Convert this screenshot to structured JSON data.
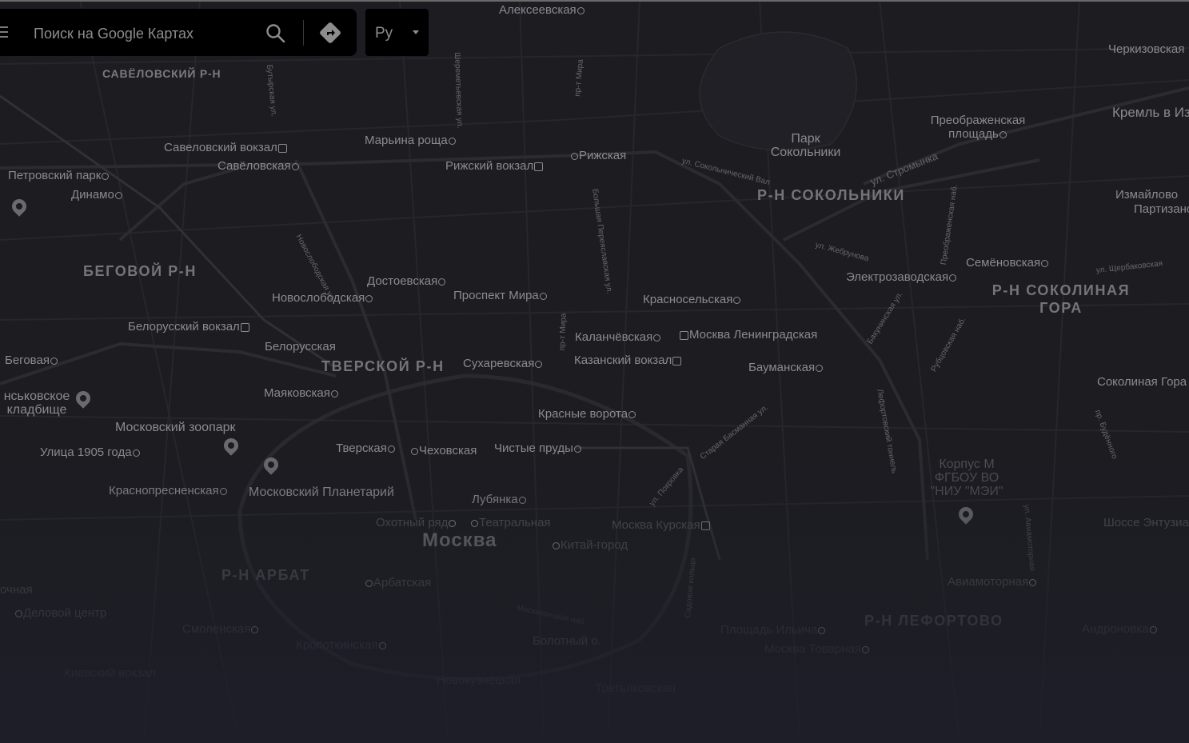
{
  "search": {
    "placeholder": "Поиск на Google Картах",
    "language": "Ру"
  },
  "icons": {
    "menu": "hamburger-icon",
    "search": "search-icon",
    "directions": "directions-icon",
    "language_caret": "caret-down-icon"
  },
  "colors": {
    "map_background": "#1c1c21",
    "search_panel": "#000000",
    "label": "#8a8a8f"
  },
  "map": {
    "districts": {
      "savelovsky": "САВЁЛОВСКИЙ Р-Н",
      "begovoy": "БЕГОВОЙ Р-Н",
      "tverskoy": "ТВЕРСКОЙ Р-Н",
      "arbat": "Р-Н АРБАТ",
      "sokolniki": "Р-Н СОКОЛЬНИКИ",
      "sokolinaya_gora": "Р-Н СОКОЛИНАЯ ГОРА",
      "lefortovo": "Р-Н ЛЕФОРТОВО",
      "city": "Москва"
    },
    "stations": {
      "alekseevskaya": "Алексеевская",
      "savelovsky_vokzal": "Савеловский вокзал",
      "savelovskaya": "Савёловская",
      "petrovsky_park": "Петровский парк",
      "dinamo": "Динамо",
      "marina_roshcha": "Марьина роща",
      "rizhsky_vokzal": "Рижский вокзал",
      "rizhskaya": "Рижская",
      "dostoevskaya": "Достоевская",
      "novoslobodskaya": "Новослободская",
      "prospekt_mira": "Проспект Мира",
      "belorussky_vokzal": "Белорусский вокзал",
      "belorusskaya": "Белорусская",
      "begovaya": "Беговая",
      "mayakovskaya": "Маяковская",
      "sukharevskaya": "Сухаревская",
      "kalanchevskaya": "Каланчёвская",
      "moskva_leningradskaya": "Москва Ленинградская",
      "kazansky_vokzal": "Казанский вокзал",
      "krasnoselskaya": "Красносельская",
      "baumanskaya": "Бауманская",
      "krasnye_vorota": "Красные ворота",
      "ulitsa_1905": "Улица 1905 года",
      "tverskaya": "Тверская",
      "chekhovskaya": "Чеховская",
      "chistye_prudy": "Чистые пруды",
      "krasnopresnenskaya": "Краснопресненская",
      "lubyanka": "Лубянка",
      "okhotny_ryad": "Охотный ряд",
      "teatralnaya": "Театральная",
      "moskva_kurskaya": "Москва Курская",
      "kitay_gorod": "Китай-город",
      "arbatskaya": "Арбатская",
      "delovoy_tsentr": "Деловой центр",
      "smolenskaya": "Смоленская",
      "kropotkinskaya": "Кропоткинская",
      "preobrazhenskaya": "Преображенская площадь",
      "semenovskaya": "Семёновская",
      "elektrozavodskaya": "Электрозаводская",
      "aviamotornaya": "Авиамоторная",
      "ploshchad_ilyicha": "Площадь Ильича",
      "moskva_tovarnaya": "Москва Товарная",
      "andronovka": "Андроновка",
      "kievsky_vokzal": "Киевский вокзал",
      "novokuznetskaya": "Новокузнецкая",
      "tretyakovskaya": "Третьяковская",
      "izmaylovo": "Измайлово",
      "partizanskaya": "Партизанская",
      "sokolinaya_gora_st": "Соколиная Гора",
      "shosse_entuziastov": "Шоссе Энтузиастов",
      "cherkizovskaya": "Черкизовская",
      "kreml_v_izmaylovo": "Кремль в Из",
      "nochnaya": "очная"
    },
    "pois": {
      "park_sokolniki": "Парк Сокольники",
      "zoo": "Московский зоопарк",
      "planetarium": "Московский Планетарий",
      "vagankovskoe": "нськовское кладбище",
      "korpus_m": "Корпус М ФГБОУ ВО \"НИУ \"МЭИ\"",
      "bolotny": "Болотный о."
    },
    "streets": {
      "novoslobodskaya_ul": "Новослободская ул.",
      "butyrskaya_ul": "Бутырская ул.",
      "sheremetyevskaya": "Шереметьевская ул.",
      "prospekt_mira_n": "пр-т Мира",
      "prospekt_mira_s": "пр-т Мира",
      "bolshaya_pereyaslavskaya": "Большая Переяславская ул.",
      "sokolnichesky_val": "ул. Сокольнический Вал",
      "stromynka": "ул. Стромынка",
      "zherebunova": "ул. Жебрунова",
      "shcherbakovskaya": "ул. Щербаковская",
      "preobrazhenskaya_nab": "Преображенская наб.",
      "bakuninskaya": "Бакунинская ул.",
      "rubtsovskaya": "Рубцовская наб.",
      "lefortovsky_tunnel": "Лефортовский тоннель",
      "staraya_basmannaya": "Старая Басманная ул.",
      "pokrovka": "ул. Покровка",
      "sadovoe_koltso": "Садовое кольцо",
      "budennogo": "пр. Будённого",
      "aviamotornaya_ul": "ул. Авиамоторная",
      "moskvoretskaya": "Москворецкая наб."
    }
  }
}
